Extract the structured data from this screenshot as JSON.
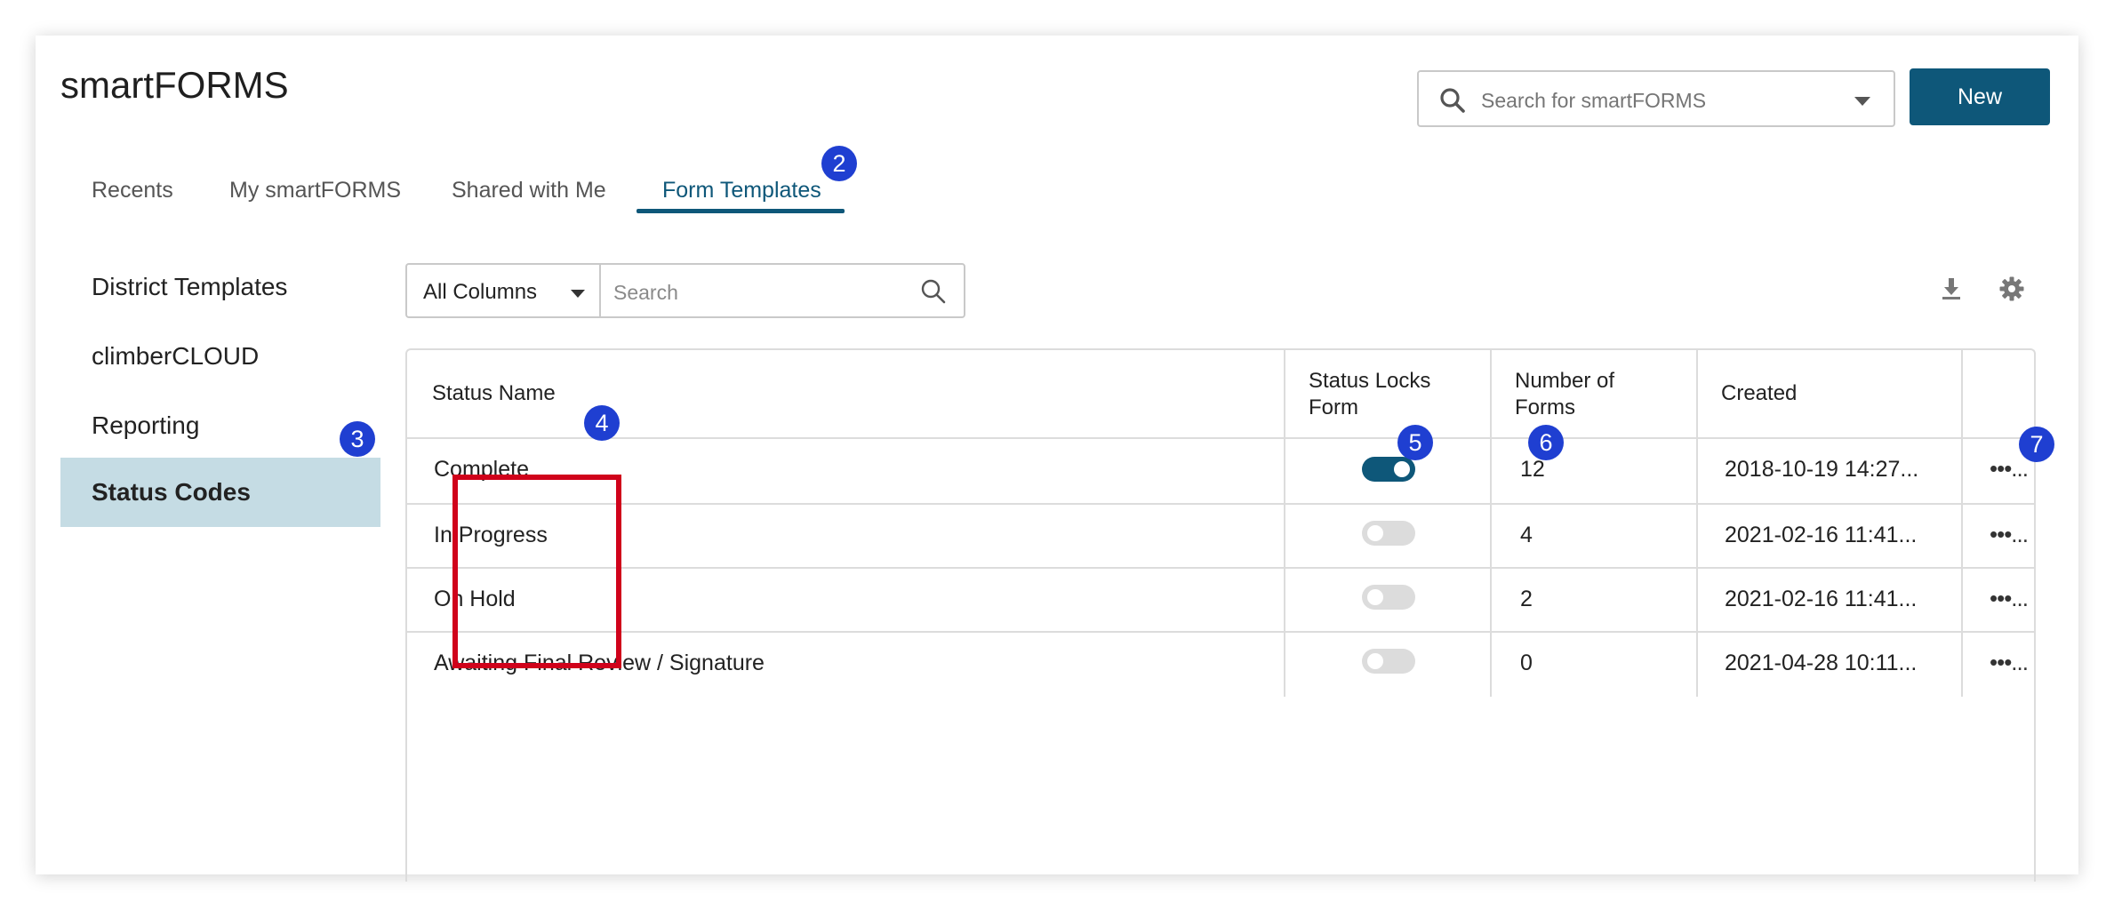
{
  "app": {
    "title": "smartFORMS"
  },
  "header": {
    "search_placeholder": "Search for smartFORMS",
    "new_label": "New"
  },
  "tabs": [
    {
      "label": "Recents"
    },
    {
      "label": "My smartFORMS"
    },
    {
      "label": "Shared with Me"
    },
    {
      "label": "Form Templates",
      "active": true
    }
  ],
  "sidebar": {
    "items": [
      {
        "label": "District Templates"
      },
      {
        "label": "climberCLOUD"
      },
      {
        "label": "Reporting"
      },
      {
        "label": "Status Codes",
        "active": true
      }
    ]
  },
  "table_toolbar": {
    "column_select": "All Columns",
    "search_placeholder": "Search",
    "icons": [
      "download-icon",
      "gear-icon"
    ]
  },
  "table": {
    "headers": {
      "status_name": "Status Name",
      "locks_line1": "Status Locks",
      "locks_line2": "Form",
      "forms_line1": "Number of",
      "forms_line2": "Forms",
      "created": "Created"
    },
    "rows": [
      {
        "name": "Complete",
        "locks": true,
        "count": "12",
        "created": "2018-10-19 14:27...",
        "more": "•••..."
      },
      {
        "name": "In Progress",
        "locks": false,
        "count": "4",
        "created": "2021-02-16 11:41...",
        "more": "•••..."
      },
      {
        "name": "On Hold",
        "locks": false,
        "count": "2",
        "created": "2021-02-16 11:41...",
        "more": "•••..."
      },
      {
        "name": "Awaiting Final Review / Signature",
        "locks": false,
        "count": "0",
        "created": "2021-04-28 10:11...",
        "more": "•••..."
      }
    ]
  },
  "annotations": {
    "badges": [
      "2",
      "3",
      "4",
      "5",
      "6",
      "7"
    ],
    "badge_color": "#1f3fd1",
    "highlight_color": "#d0021b"
  },
  "colors": {
    "accent": "#0e5779",
    "active_sidebar": "#c5dce4"
  }
}
